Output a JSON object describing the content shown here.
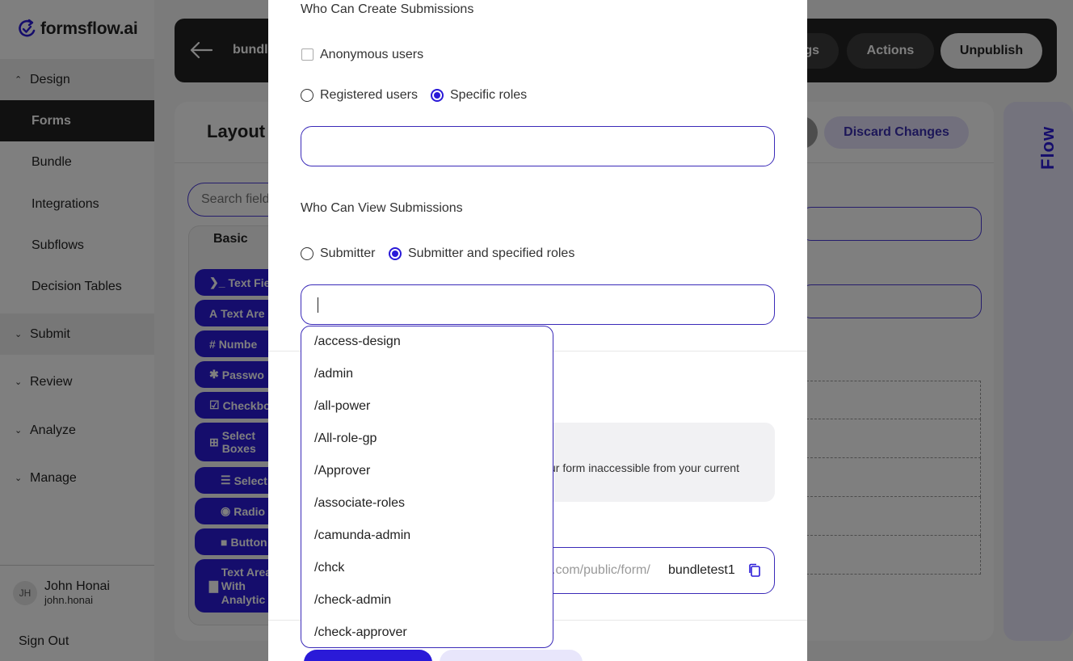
{
  "app": {
    "logo_text": "formsflow.ai"
  },
  "sidebar": {
    "sections": [
      {
        "label": "Design",
        "expanded": true
      },
      {
        "label": "Submit",
        "expanded": false
      },
      {
        "label": "Review",
        "expanded": false
      },
      {
        "label": "Analyze",
        "expanded": false
      },
      {
        "label": "Manage",
        "expanded": false
      }
    ],
    "design_items": [
      "Forms",
      "Bundle",
      "Integrations",
      "Subflows",
      "Decision Tables"
    ],
    "active_item": "Forms",
    "user": {
      "initials": "JH",
      "name": "John Honai",
      "email": "john.honai"
    },
    "sign_out": "Sign Out"
  },
  "topbar": {
    "form_title": "bundl",
    "settings_label": "gs",
    "actions_label": "Actions",
    "unpublish_label": "Unpublish"
  },
  "builder": {
    "title": "Layout",
    "discard_label": "Discard Changes",
    "search_placeholder": "Search field",
    "tab_basic": "Basic",
    "components": [
      {
        "label": "Text Fie",
        "icon": "terminal-icon"
      },
      {
        "label": "Text Are",
        "icon": "text-icon"
      },
      {
        "label": "Numbe",
        "icon": "hash-icon"
      },
      {
        "label": "Passwo",
        "icon": "asterisk-icon"
      },
      {
        "label": "Checkbo",
        "icon": "checkbox-icon"
      },
      {
        "label": "Select Boxes",
        "icon": "plus-square-icon"
      },
      {
        "label": "Select",
        "icon": "list-icon"
      },
      {
        "label": "Radio",
        "icon": "radio-icon"
      },
      {
        "label": "Button",
        "icon": "stop-icon"
      },
      {
        "label": "Text Area With Analytic",
        "icon": "chart-icon"
      }
    ],
    "flow_label": "Flow"
  },
  "modal": {
    "create_heading": "Who Can Create Submissions",
    "anonymous_label": "Anonymous users",
    "anonymous_checked": false,
    "registered_label": "Registered users",
    "specific_roles_label": "Specific roles",
    "create_selected": "Specific roles",
    "view_heading": "Who Can View Submissions",
    "submitter_label": "Submitter",
    "submitter_roles_label": "Submitter and specified roles",
    "view_selected": "Submitter and specified roles",
    "info_text": "ur form inaccessible from your current",
    "url_prefix": "s.com/public/form/",
    "url_value": "bundletest1"
  },
  "dropdown": {
    "options": [
      "/access-design",
      "/admin",
      "/all-power",
      "/All-role-gp",
      "/Approver",
      "/associate-roles",
      "/camunda-admin",
      "/chck",
      "/check-admin",
      "/check-approver"
    ]
  },
  "colors": {
    "primary": "#2a1ad8",
    "dark": "#222222",
    "accent_light": "#e8e6fb"
  }
}
